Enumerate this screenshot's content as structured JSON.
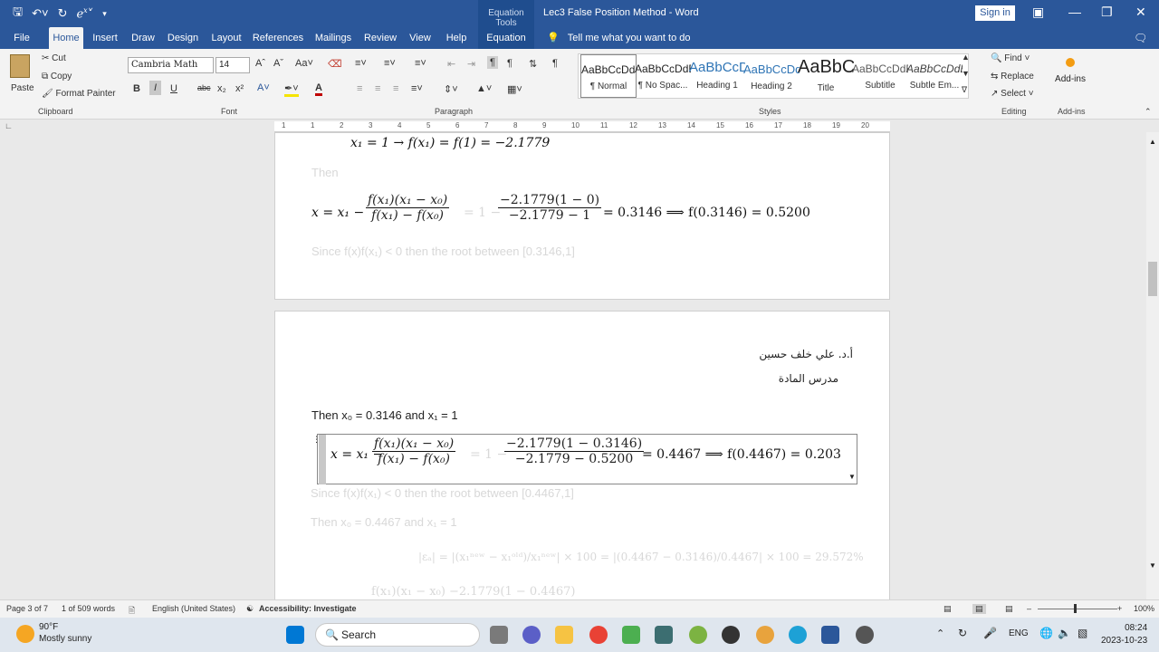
{
  "titlebar": {
    "context_tool": "Equation Tools",
    "title": "Lec3 False Position Method  -  Word",
    "sign_in": "Sign in",
    "qat_icons": [
      "save-icon",
      "undo-icon",
      "redo-icon",
      "equation-icon",
      "customize-icon"
    ]
  },
  "tabs": [
    "File",
    "Home",
    "Insert",
    "Draw",
    "Design",
    "Layout",
    "References",
    "Mailings",
    "Review",
    "View",
    "Help",
    "Equation"
  ],
  "active_tab": "Home",
  "tell_me": "Tell me what you want to do",
  "ribbon": {
    "clipboard": {
      "paste": "Paste",
      "cut": "Cut",
      "copy": "Copy",
      "format_painter": "Format Painter",
      "label": "Clipboard"
    },
    "font": {
      "name": "Cambria Math",
      "size": "14",
      "label": "Font",
      "bold": "B",
      "italic": "I",
      "underline": "U",
      "strike": "abc",
      "sub": "x₂",
      "sup": "x²",
      "font_color": "A"
    },
    "paragraph": {
      "label": "Paragraph"
    },
    "styles": {
      "label": "Styles",
      "items": [
        {
          "preview": "AaBbCcDdEe",
          "name": "¶ Normal"
        },
        {
          "preview": "AaBbCcDdEe",
          "name": "¶ No Spac..."
        },
        {
          "preview": "AaBbCcDdEe",
          "name": "Heading 1"
        },
        {
          "preview": "AaBbCcDdEe",
          "name": "Heading 2"
        },
        {
          "preview": "AaBbCcDdEe",
          "name": "Title"
        },
        {
          "preview": "AaBbCcDdEe",
          "name": "Subtitle"
        },
        {
          "preview": "AaBbCcDdEe",
          "name": "Subtle Em..."
        }
      ]
    },
    "editing": {
      "find": "Find",
      "replace": "Replace",
      "select": "Select",
      "label": "Editing"
    },
    "addins": {
      "name": "Add-ins",
      "label": "Add-ins"
    }
  },
  "ruler_ticks": [
    "1",
    "1",
    "2",
    "3",
    "4",
    "5",
    "6",
    "7",
    "8",
    "9",
    "10",
    "11",
    "12",
    "13",
    "14",
    "15",
    "16",
    "17",
    "18",
    "19",
    "20"
  ],
  "document": {
    "page1": {
      "line_top": "x₁ = 1   →   f(x₁) = f(1) = −2.1779",
      "then": "Then",
      "eq1_lhs": "x = x₁ −",
      "eq1_num": "f(x₁)(x₁ − x₀)",
      "eq1_den": "f(x₁) − f(x₀)",
      "eq1_mid": "= 1 −",
      "eq1_num2": "−2.1779(1 − 0)",
      "eq1_den2": "−2.1779 − 1",
      "eq1_res": "= 0.3146 ⟹ f(0.3146) = 0.5200",
      "since": "Since f(x)f(x₁) < 0 then the root between [0.3146,1]"
    },
    "page2": {
      "author": "أ.د. علي خلف حسين",
      "role": "مدرس المادة",
      "then_line": "Then x₀ = 0.3146 and x₁ = 1",
      "eq2_lhs": "x = x₁ −",
      "eq2_num": "f(x₁)(x₁ − x₀)",
      "eq2_den": "f(x₁) − f(x₀)",
      "eq2_mid": "= 1 −",
      "eq2_num2": "−2.1779(1 − 0.3146)",
      "eq2_den2": "−2.1779 − 0.5200",
      "eq2_res": "= 0.4467 ⟹ f(0.4467) = 0.2035",
      "since2": "Since f(x)f(x₁) < 0 then the root between [0.4467,1]",
      "then2": "Then x₀ = 0.4467 and x₁ = 1",
      "err": "|εₐ| = |(x₁ⁿᵉʷ − x₁ᵒˡᵈ)/x₁ⁿᵉʷ| × 100 = |(0.4467 − 0.3146)/0.4467| × 100 = 29.572%",
      "bottom": "f(x₁)(x₁ − x₀)            −2.1779(1 − 0.4467)"
    }
  },
  "statusbar": {
    "page": "Page 3 of 7",
    "words": "1 of 509 words",
    "language": "English (United States)",
    "accessibility": "Accessibility: Investigate",
    "zoom": "100%"
  },
  "taskbar": {
    "temp": "90°F",
    "weather": "Mostly sunny",
    "search": "Search",
    "lang": "ENG",
    "time": "08:24",
    "date": "2023-10-23"
  }
}
